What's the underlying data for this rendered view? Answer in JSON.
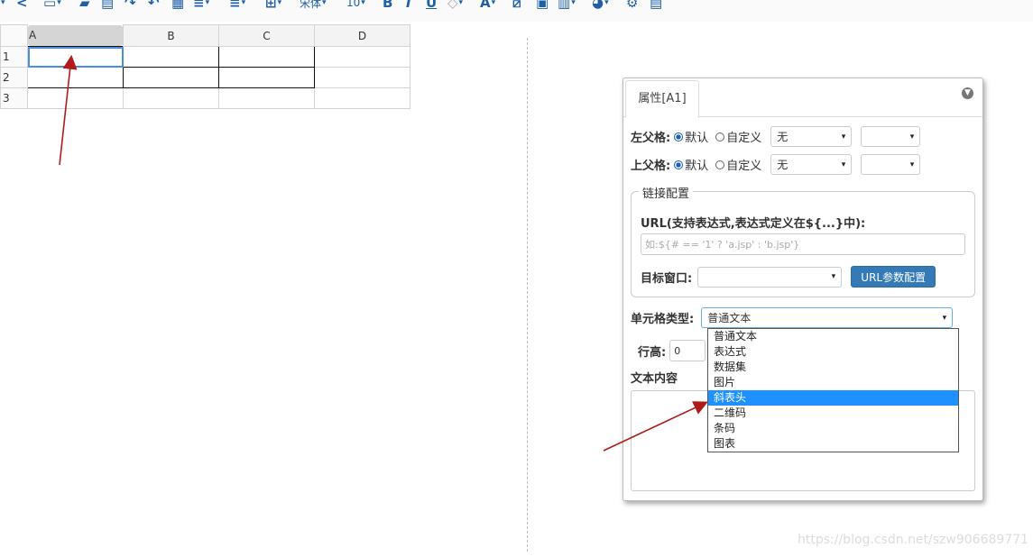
{
  "toolbar": {
    "items": [
      {
        "icon": "share-icon",
        "glyph": "<"
      },
      {
        "icon": "save-icon",
        "glyph": "▭"
      },
      {
        "icon": "open-folder-icon",
        "glyph": "▰"
      },
      {
        "icon": "preview-icon",
        "glyph": "▤"
      },
      {
        "icon": "redo-icon",
        "glyph": "↷"
      },
      {
        "icon": "undo-icon",
        "glyph": "↶"
      },
      {
        "icon": "print-icon",
        "glyph": "▦"
      },
      {
        "icon": "align-icon",
        "glyph": "≡"
      },
      {
        "icon": "valign-icon",
        "glyph": "≡"
      },
      {
        "icon": "border-icon",
        "glyph": "⊞"
      }
    ],
    "font_name": "宋体",
    "font_size": "10",
    "bold": "B",
    "italic": "I",
    "underline": "U"
  },
  "sheet": {
    "columns": [
      "A",
      "B",
      "C",
      "D"
    ],
    "rows": [
      "1",
      "2",
      "3"
    ]
  },
  "panel": {
    "tab_label": "属性[A1]",
    "left_parent": {
      "label": "左父格:",
      "opt_default": "默认",
      "opt_custom": "自定义",
      "select_value": "无",
      "select2_value": ""
    },
    "top_parent": {
      "label": "上父格:",
      "opt_default": "默认",
      "opt_custom": "自定义",
      "select_value": "无",
      "select2_value": ""
    },
    "link": {
      "legend": "链接配置",
      "url_label": "URL(支持表达式,表达式定义在${...}中):",
      "url_placeholder": "如:${# == '1' ? 'a.jsp' : 'b.jsp'}",
      "target_label": "目标窗口:",
      "target_value": "",
      "param_button": "URL参数配置"
    },
    "cell_type": {
      "label": "单元格类型:",
      "value": "普通文本",
      "options": [
        "普通文本",
        "表达式",
        "数据集",
        "图片",
        "斜表头",
        "二维码",
        "条码",
        "图表"
      ],
      "highlighted": "斜表头"
    },
    "row_height": {
      "label": "行高:",
      "value": "0"
    },
    "text_content_label": "文本内容"
  },
  "watermark": "https://blog.csdn.net/szw906689771",
  "colors": {
    "accent": "#337ab7",
    "highlight": "#1e90ff",
    "arrow": "#b01c1c"
  }
}
